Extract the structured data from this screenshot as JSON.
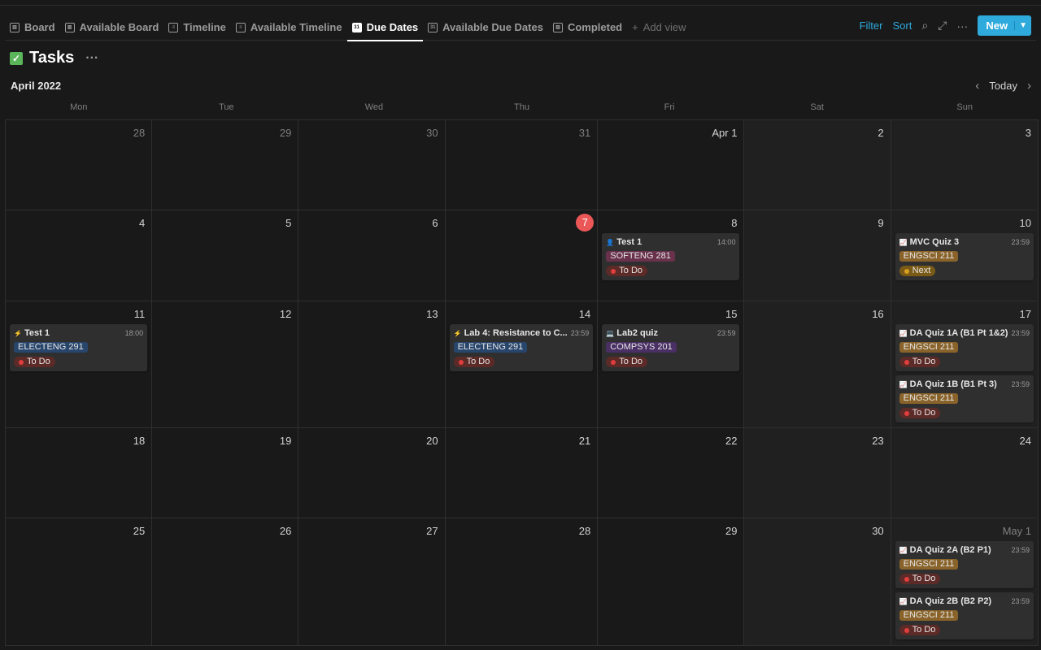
{
  "tabs": [
    {
      "label": "Board",
      "icon": "board-icon"
    },
    {
      "label": "Available Board",
      "icon": "board-icon"
    },
    {
      "label": "Timeline",
      "icon": "timeline-icon"
    },
    {
      "label": "Available Timeline",
      "icon": "timeline-icon"
    },
    {
      "label": "Due Dates",
      "icon": "calendar-icon",
      "active": true
    },
    {
      "label": "Available Due Dates",
      "icon": "calendar-icon"
    },
    {
      "label": "Completed",
      "icon": "board-icon"
    }
  ],
  "add_view": "Add view",
  "toolbar": {
    "filter": "Filter",
    "sort": "Sort",
    "new": "New"
  },
  "title": "Tasks",
  "month": "April 2022",
  "today": "Today",
  "weekdays": [
    "Mon",
    "Tue",
    "Wed",
    "Thu",
    "Fri",
    "Sat",
    "Sun"
  ],
  "colors": {
    "accent": "#2eaadc",
    "today": "#eb5757",
    "todo": "#e03e3e",
    "next": "#d9a020",
    "softeng": "#69314c",
    "electeng": "#28456c",
    "compsys": "#492f64",
    "engsci": "#89632a"
  },
  "days": [
    {
      "n": "28",
      "out": true
    },
    {
      "n": "29",
      "out": true
    },
    {
      "n": "30",
      "out": true
    },
    {
      "n": "31",
      "out": true
    },
    {
      "n": "Apr 1"
    },
    {
      "n": "2"
    },
    {
      "n": "3"
    },
    {
      "n": "4"
    },
    {
      "n": "5"
    },
    {
      "n": "6"
    },
    {
      "n": "7",
      "today": true
    },
    {
      "n": "8",
      "cards": [
        {
          "icon": "👤",
          "name": "Test 1",
          "time": "14:00",
          "tag": "SOFTENG 281",
          "tagc": "#69314c",
          "status": "To Do"
        }
      ]
    },
    {
      "n": "9"
    },
    {
      "n": "10",
      "cards": [
        {
          "icon": "📈",
          "name": "MVC Quiz 3",
          "time": "23:59",
          "tag": "ENGSCI 211",
          "tagc": "#89632a",
          "status": "Next"
        }
      ]
    },
    {
      "n": "11",
      "cards": [
        {
          "icon": "⚡",
          "name": "Test 1",
          "time": "18:00",
          "tag": "ELECTENG 291",
          "tagc": "#28456c",
          "status": "To Do"
        }
      ]
    },
    {
      "n": "12"
    },
    {
      "n": "13"
    },
    {
      "n": "14",
      "cards": [
        {
          "icon": "⚡",
          "name": "Lab 4: Resistance to C...",
          "time": "23:59",
          "tag": "ELECTENG 291",
          "tagc": "#28456c",
          "status": "To Do"
        }
      ]
    },
    {
      "n": "15",
      "cards": [
        {
          "icon": "💻",
          "name": "Lab2 quiz",
          "time": "23:59",
          "tag": "COMPSYS 201",
          "tagc": "#492f64",
          "status": "To Do"
        }
      ]
    },
    {
      "n": "16"
    },
    {
      "n": "17",
      "cards": [
        {
          "icon": "📈",
          "name": "DA Quiz 1A (B1 Pt 1&2)",
          "time": "23:59",
          "tag": "ENGSCI 211",
          "tagc": "#89632a",
          "status": "To Do"
        },
        {
          "icon": "📈",
          "name": "DA Quiz 1B (B1 Pt 3)",
          "time": "23:59",
          "tag": "ENGSCI 211",
          "tagc": "#89632a",
          "status": "To Do"
        }
      ]
    },
    {
      "n": "18"
    },
    {
      "n": "19"
    },
    {
      "n": "20"
    },
    {
      "n": "21"
    },
    {
      "n": "22"
    },
    {
      "n": "23"
    },
    {
      "n": "24"
    },
    {
      "n": "25"
    },
    {
      "n": "26"
    },
    {
      "n": "27"
    },
    {
      "n": "28"
    },
    {
      "n": "29"
    },
    {
      "n": "30"
    },
    {
      "n": "May 1",
      "out": true,
      "cards": [
        {
          "icon": "📈",
          "name": "DA Quiz 2A (B2 P1)",
          "time": "23:59",
          "tag": "ENGSCI 211",
          "tagc": "#89632a",
          "status": "To Do"
        },
        {
          "icon": "📈",
          "name": "DA Quiz 2B (B2 P2)",
          "time": "23:59",
          "tag": "ENGSCI 211",
          "tagc": "#89632a",
          "status": "To Do"
        }
      ]
    }
  ]
}
